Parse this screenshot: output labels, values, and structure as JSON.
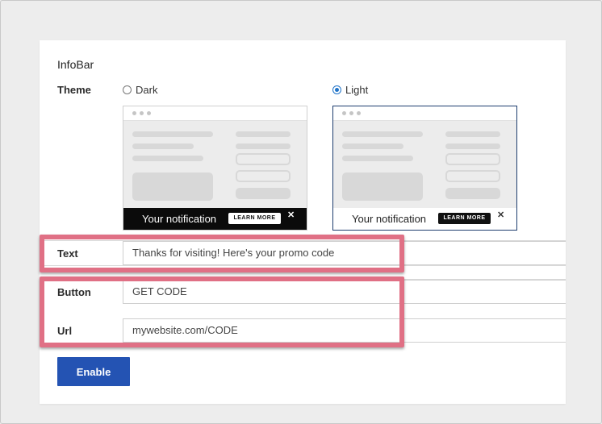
{
  "card": {
    "title": "InfoBar"
  },
  "theme": {
    "label": "Theme",
    "options": [
      {
        "label": "Dark",
        "selected": false
      },
      {
        "label": "Light",
        "selected": true
      }
    ],
    "preview": {
      "notification_text": "Your notification",
      "button_label": "LEARN MORE",
      "close_glyph": "✕"
    }
  },
  "fields": {
    "text": {
      "label": "Text",
      "value": "Thanks for visiting! Here's your promo code"
    },
    "button": {
      "label": "Button",
      "value": "GET CODE"
    },
    "url": {
      "label": "Url",
      "value": "mywebsite.com/CODE"
    }
  },
  "actions": {
    "enable_label": "Enable"
  },
  "colors": {
    "accent": "#2453b3",
    "radio_selected": "#1f73c8",
    "highlight": "#e07085"
  }
}
